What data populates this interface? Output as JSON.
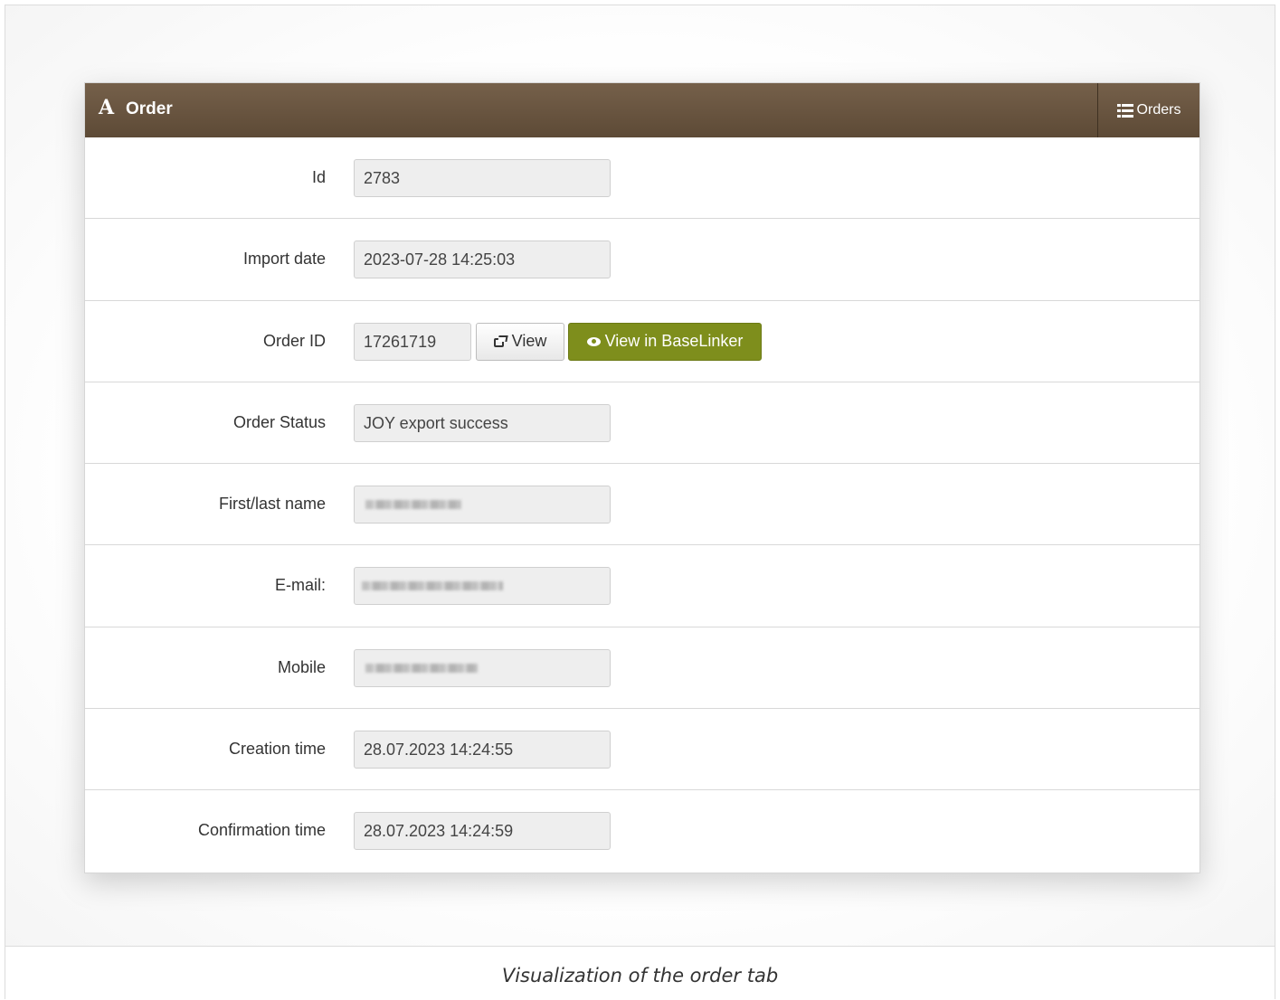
{
  "panel": {
    "icon": "A",
    "title": "Order",
    "orders_button": "Orders"
  },
  "fields": {
    "id": {
      "label": "Id",
      "value": "2783"
    },
    "import_date": {
      "label": "Import date",
      "value": "2023-07-28 14:25:03"
    },
    "order_id": {
      "label": "Order ID",
      "value": "17261719"
    },
    "order_status": {
      "label": "Order Status",
      "value": "JOY export success"
    },
    "name": {
      "label": "First/last name"
    },
    "email": {
      "label": "E-mail:"
    },
    "mobile": {
      "label": "Mobile"
    },
    "creation_time": {
      "label": "Creation time",
      "value": "28.07.2023 14:24:55"
    },
    "confirmation_time": {
      "label": "Confirmation time",
      "value": "28.07.2023 14:24:59"
    }
  },
  "buttons": {
    "view": "View",
    "view_in_baselinker": "View in BaseLinker"
  },
  "caption": "Visualization of the order tab",
  "colors": {
    "header": "#6b5640",
    "baselinker_button": "#7e8e1c"
  }
}
